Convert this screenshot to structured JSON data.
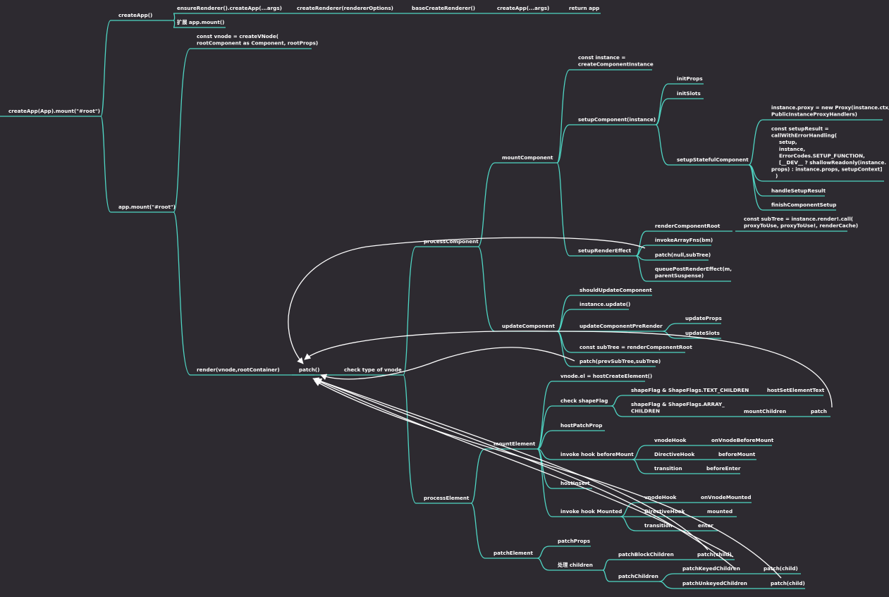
{
  "colors": {
    "background": "#2d2a30",
    "branch": "#4fd6c4",
    "text": "#ffffff",
    "arrow": "#ffffff"
  },
  "nodes": {
    "root": [
      "createApp(App).mount(\"#root\")"
    ],
    "createApp": [
      "createApp()"
    ],
    "ensureRenderer": [
      "ensureRenderer().createApp(...args)"
    ],
    "createRenderer": [
      "createRenderer(rendererOptions)"
    ],
    "baseCreateRenderer": [
      "baseCreateRenderer()"
    ],
    "createApp2": [
      "createApp(...args)"
    ],
    "returnApp": [
      "return app"
    ],
    "extendMount": [
      "扩展 app.mount()"
    ],
    "appMount": [
      "app.mount(\"#root\")"
    ],
    "createVNode": [
      "const vnode = createVNode(",
      "rootComponent as Component, rootProps)"
    ],
    "render": [
      "render(vnode,rootContainer)"
    ],
    "patch": [
      "patch()"
    ],
    "checkType": [
      "check type of vnode"
    ],
    "processComponent": [
      "processComponent"
    ],
    "mountComponent": [
      "mountComponent"
    ],
    "createInstance": [
      "const instance =",
      "createComponentInstance"
    ],
    "setupComponent": [
      "setupComponent(instance)"
    ],
    "initProps": [
      "initProps"
    ],
    "initSlots": [
      "initSlots"
    ],
    "setupStateful": [
      "setupStatefulComponent"
    ],
    "instanceProxy": [
      "instance.proxy = new Proxy(instance.ctx,",
      "PublicInstanceProxyHandlers)"
    ],
    "setupResult": [
      "const setupResult =",
      "callWithErrorHandling(",
      "setup,",
      "instance,",
      "ErrorCodes.SETUP_FUNCTION,",
      "[__DEV__ ? shallowReadonly(instance.",
      "props) : instance.props, setupContext]",
      ")"
    ],
    "handleSetupResult": [
      "handleSetupResult"
    ],
    "finishComponentSetup": [
      "finishComponentSetup"
    ],
    "setupRenderEffect": [
      "setupRenderEffect"
    ],
    "renderComponentRoot": [
      "renderComponentRoot"
    ],
    "subTreeCall": [
      "const subTree = instance.render!.call(",
      "proxyToUse, proxyToUse!, renderCache)"
    ],
    "invokeArrayFns": [
      "invokeArrayFns(bm)"
    ],
    "patchNullSubTree": [
      "patch(null,subTree)"
    ],
    "queuePostRender": [
      "queuePostRenderEffect(m,",
      "parentSuspense)"
    ],
    "updateComponent": [
      "updateComponent"
    ],
    "shouldUpdate": [
      "shouldUpdateComponent"
    ],
    "instanceUpdate": [
      "instance.update()"
    ],
    "updatePreRender": [
      "updateComponentPreRender"
    ],
    "updateProps": [
      "updateProps"
    ],
    "updateSlots": [
      "updateSlots"
    ],
    "constSubTree": [
      "const subTree = renderComponentRoot"
    ],
    "patchPrevSubTree": [
      "patch(prevSubTree,subTree)"
    ],
    "processElement": [
      "processElement"
    ],
    "mountElement": [
      "mountElement"
    ],
    "vnodeEl": [
      "vnode.el = hostCreateElement()"
    ],
    "checkShapeFlag": [
      "check shapeFlag"
    ],
    "shapeText": [
      "shapeFlag & ShapeFlags.TEXT_CHILDREN"
    ],
    "hostSetElementText": [
      "hostSetElementText"
    ],
    "shapeArray": [
      "shapeFlag & ShapeFlags.ARRAY_",
      "CHILDREN"
    ],
    "mountChildren": [
      "mountChildren"
    ],
    "patchLeaf": [
      "patch"
    ],
    "hostPatchProp": [
      "hostPatchProp"
    ],
    "invokeBeforeMount": [
      "invoke hook beforeMount"
    ],
    "vnodeHook1": [
      "vnodeHook"
    ],
    "onVnodeBeforeMount": [
      "onVnodeBeforeMount"
    ],
    "directiveHook1": [
      "DirectiveHook"
    ],
    "beforeMount": [
      "beforeMount"
    ],
    "transition1": [
      "transition"
    ],
    "beforeEnter": [
      "beforeEnter"
    ],
    "hostInsert": [
      "hostInsert"
    ],
    "invokeMounted": [
      "invoke hook Mounted"
    ],
    "vnodeHook2": [
      "vnodeHook"
    ],
    "onVnodeMounted": [
      "onVnodeMounted"
    ],
    "directiveHook2": [
      "DirectiveHook"
    ],
    "mounted": [
      "mounted"
    ],
    "transition2": [
      "transition"
    ],
    "enter": [
      "enter"
    ],
    "patchElement": [
      "patchElement"
    ],
    "patchProps": [
      "patchProps"
    ],
    "handleChildren": [
      "处理 children"
    ],
    "patchBlockChildren": [
      "patchBlockChildren"
    ],
    "patchChild1": [
      "patch(child)"
    ],
    "patchChildren": [
      "patchChildren"
    ],
    "patchKeyed": [
      "patchKeyedChildren"
    ],
    "patchChild2": [
      "patch(child)"
    ],
    "patchUnkeyed": [
      "patchUnkeyedChildren"
    ],
    "patchChild3": [
      "patch(child)"
    ]
  }
}
